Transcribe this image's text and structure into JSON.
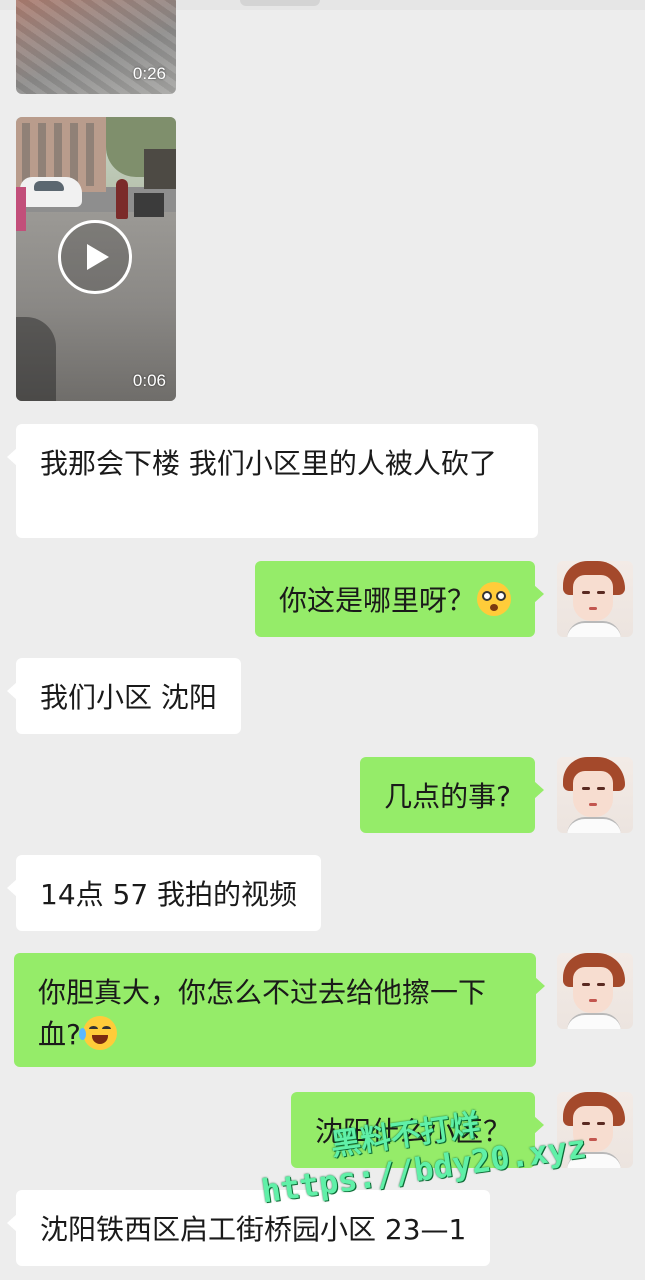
{
  "chat": {
    "video1": {
      "duration": "0:26"
    },
    "video2": {
      "duration": "0:06"
    },
    "m1": "我那会下楼 我们小区里的人被人砍了",
    "m2": "你这是哪里呀？",
    "m3": "我们小区  沈阳",
    "m4": "几点的事?",
    "m5": "14点 57 我拍的视频",
    "m6": "你胆真大，你怎么不过去给他擦一下血?",
    "m7": "沈阳什么小区？",
    "m8": "沈阳铁西区启工街桥园小区 23—1"
  },
  "icons": {
    "shock_emoji": "astonished-face-icon",
    "laugh_emoji": "tears-of-joy-icon",
    "play": "play-icon"
  },
  "colors": {
    "outgoing_bubble": "#95ec69",
    "incoming_bubble": "#ffffff",
    "background": "#ededed",
    "watermark": "#60f0a8"
  },
  "watermark": {
    "line1": "黑料不打烊",
    "line2": "https://bdy20.xyz"
  }
}
